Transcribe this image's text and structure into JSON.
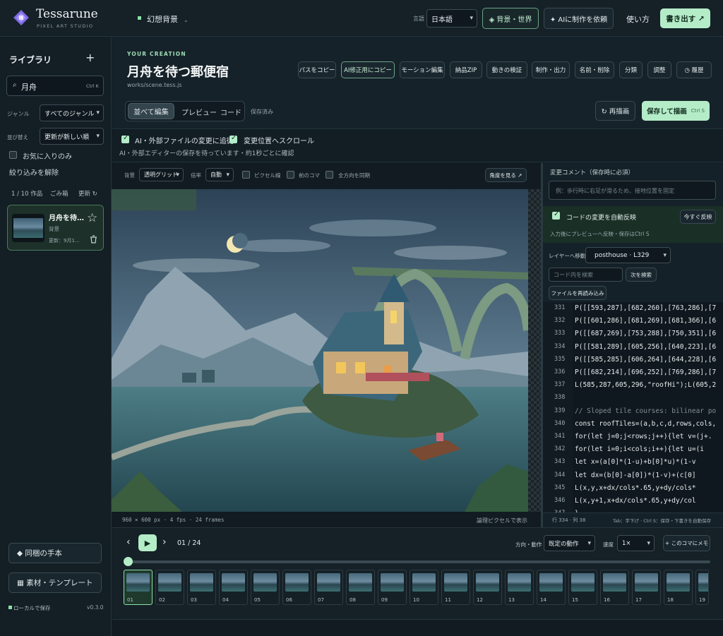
{
  "app": {
    "name": "Tessarune",
    "subtitle": "PIXEL ART STUDIO",
    "doc_tab": "幻想背景"
  },
  "header": {
    "lang_label": "言語",
    "lang_value": "日本語",
    "world_btn": "◈ 背景・世界",
    "ai_btn": "✦ AIに制作を依頼",
    "help": "使い方",
    "export_btn": "書き出す ↗"
  },
  "sidebar": {
    "title": "ライブラリ",
    "add": "+",
    "search_value": "月舟",
    "search_shortcut": "Ctrl K",
    "genre_label": "ジャンル",
    "genre_value": "すべてのジャンル",
    "sort_label": "並び替え",
    "sort_value": "更新が新しい順",
    "fav_label": "お気に入りのみ",
    "clear_filter": "絞り込みを解除",
    "count": "1 / 10 作品",
    "trash": "ごみ箱",
    "refresh": "更新 ↻",
    "item": {
      "title": "月舟を待…",
      "genre": "背景",
      "updated": "更新：9月1…"
    },
    "guide_btn": "◆ 同梱の手本",
    "assets_btn": "▦ 素材・テンプレート",
    "local_save": "ローカルで保存",
    "version": "v0.3.0"
  },
  "creation": {
    "kicker": "YOUR CREATION",
    "title": "月舟を待つ郵便宿",
    "path": "works/scene.tess.js",
    "actions": [
      "パスをコピー",
      "AI修正用にコピー",
      "モーション編集",
      "納品ZIP",
      "動きの検証",
      "制作・出力",
      "名前・削除",
      "分類",
      "調整",
      "◷ 履歴"
    ],
    "tabs": [
      "並べて編集",
      "プレビュー",
      "コード"
    ],
    "saved": "保存済み",
    "redraw": "↻ 再描画",
    "save_redraw": "保存して描画",
    "save_shortcut": "Ctrl S",
    "track_changes": "AI・外部ファイルの変更に追従",
    "scroll_change": "変更位置へスクロール",
    "watch_note": "AI・外部エディターの保存を待っています・約1秒ごとに確認"
  },
  "preview": {
    "bg_label": "背景",
    "bg_value": "透明グリッド",
    "scale_label": "倍率",
    "scale_value": "自動",
    "pixel_grid": "ピクセル線",
    "prev_frame": "前のコマ",
    "sync_dirs": "全方向を同期",
    "view_angle": "角度を見る ↗",
    "status": "960 × 600 px · 4 fps · 24 frames",
    "logical": "論理ピクセルで表示"
  },
  "editor": {
    "comment_label": "変更コメント（保存時に必須）",
    "comment_placeholder": "例：歩行時に右足が滑るため、接地位置を固定",
    "auto_apply": "コードの変更を自動反映",
    "apply_now": "今すぐ反映",
    "apply_note": "入力後にプレビューへ反映・保存はCtrl S",
    "layer_label": "レイヤーへ移動",
    "layer_value": "posthouse · L329",
    "search_placeholder": "コード内を検索",
    "next": "次を検索",
    "reload": "ファイルを再読み込み",
    "lines": [
      {
        "n": "331",
        "code": "    P([[593,287],[682,260],[763,286],[7"
      },
      {
        "n": "332",
        "code": "    P([[601,286],[681,269],[681,366],[6"
      },
      {
        "n": "333",
        "code": "    P([[687,269],[753,288],[750,351],[6"
      },
      {
        "n": "334",
        "code": "    P([[581,289],[605,256],[640,223],[6"
      },
      {
        "n": "335",
        "code": "    P([[585,285],[606,264],[644,228],[6"
      },
      {
        "n": "336",
        "code": "    P([[682,214],[696,252],[769,286],[7"
      },
      {
        "n": "337",
        "code": "    L(585,287,605,296,\"roofHi\");L(605,2"
      },
      {
        "n": "338",
        "code": ""
      },
      {
        "n": "339",
        "code": "    // Sloped tile courses: bilinear po"
      },
      {
        "n": "340",
        "code": "    const roofTiles=(a,b,c,d,rows,cols,"
      },
      {
        "n": "341",
        "code": "     for(let j=0;j<rows;j++){let v=(j+."
      },
      {
        "n": "342",
        "code": "       for(let i=0;i<cols;i++){let u=(i"
      },
      {
        "n": "343",
        "code": "         let x=(a[0]*(1-u)+b[0]*u)*(1-v"
      },
      {
        "n": "344",
        "code": "         let dx=(b[0]-a[0])*(1-v)+(c[0]"
      },
      {
        "n": "345",
        "code": "         L(x,y,x+dx/cols*.65,y+dy/cols*"
      },
      {
        "n": "346",
        "code": "         L(x,y+1,x+dx/cols*.65,y+dy/col"
      },
      {
        "n": "347",
        "code": "       }"
      }
    ],
    "status_pos": "行 334 · 列 38",
    "status_hint": "Tab：字下げ · Ctrl S：保存・下書きを自動保存"
  },
  "timeline": {
    "frame_counter": "01 / 24",
    "motion_label": "方向・動作",
    "motion_value": "既定の動作",
    "speed_label": "速度",
    "speed_value": "1×",
    "note_btn": "+ このコマにメモ",
    "frames": [
      "01",
      "02",
      "03",
      "04",
      "05",
      "06",
      "07",
      "08",
      "09",
      "10",
      "11",
      "12",
      "13",
      "14",
      "15",
      "16",
      "17",
      "18",
      "19"
    ],
    "progress": 0.0
  },
  "colors": {
    "accent": "#b4ecc8",
    "bg": "#111c24",
    "panel": "#16222a"
  }
}
